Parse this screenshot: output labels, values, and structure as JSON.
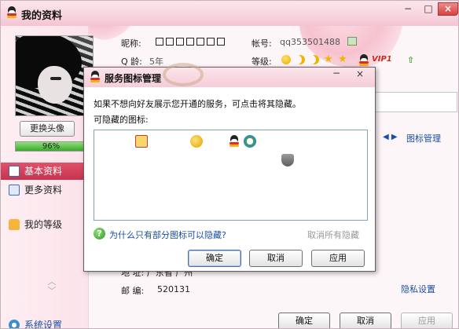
{
  "window": {
    "title": "我的资料",
    "minimize": "−",
    "maximize": "□",
    "close": "×"
  },
  "sidebar": {
    "change_avatar": "更换头像",
    "completeness": 0.96,
    "completeness_text": "96%",
    "items": [
      {
        "label": "基本资料",
        "active": true
      },
      {
        "label": "更多资料",
        "active": false
      },
      {
        "label": "我的等级",
        "active": false
      }
    ],
    "settings": "系统设置"
  },
  "profile": {
    "nickname_label": "昵称:",
    "account_label": "帐号:",
    "account_value": "qq353501488",
    "qage_label": "Q 龄:",
    "qage_value": "5年",
    "level_label": "等级:",
    "vip": "VIP1",
    "icon_manage": "图标管理",
    "address_partial": "地   址:  广东省  广州",
    "zip_label": "邮   编:",
    "zip_value": "520131",
    "privacy": "隐私设置"
  },
  "footer": {
    "ok": "确定",
    "cancel": "取消",
    "apply": "应用"
  },
  "dialog": {
    "title": "服务图标管理",
    "minimize": "−",
    "close": "×",
    "description": "如果不想向好友展示您开通的服务，可点击将其隐藏。",
    "hidable_label": "可隐藏的图标:",
    "help_link": "为什么只有部分图标可以隐藏?",
    "cancel_all": "取消所有隐藏",
    "ok": "确定",
    "cancel": "取消",
    "apply": "应用"
  },
  "colors": {
    "accent": "#c8324e",
    "link": "#1a4ea3",
    "title_bg": "#f7d1dc"
  }
}
